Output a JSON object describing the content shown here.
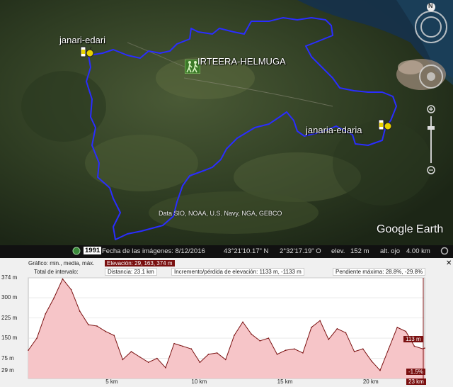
{
  "map": {
    "labels": {
      "janari_edari": "janari-edari",
      "irteera": "IRTEERA-HELMUGA",
      "janaria_edaria": "janaria-edaria"
    },
    "attribution": "Data SIO, NOAA, U.S. Navy, NGA, GEBCO",
    "brand": "Google Earth",
    "route_color": "#2a2dff",
    "compass_letter": "N"
  },
  "statusbar": {
    "year": "1991",
    "imagery_date": "Fecha de las imágenes: 8/12/2016",
    "lat": "43°21'10.17\" N",
    "lon": "2°32'17.19\" O",
    "elev_label": "elev.",
    "elev_value": "152 m",
    "eye_label": "alt. ojo",
    "eye_value": "4.00 km"
  },
  "profile": {
    "graph_label": "Gráfico: min., media, máx.",
    "elevation_stats": "Elevación: 29, 163, 374 m",
    "range_label": "Total de intervalo:",
    "distance": "Distancia: 23.1 km",
    "gain_loss": "Incremento/pérdida de elevación: 1133 m, -1133 m",
    "max_slope": "Pendiente máxima: 28.8%, -29.8%",
    "current_elev": "113 m",
    "current_slope": "-1.5%",
    "current_dist": "23 km"
  },
  "chart_data": {
    "type": "area",
    "xlabel": "",
    "ylabel": "",
    "xlim": [
      0,
      23.1
    ],
    "ylim": [
      0,
      374
    ],
    "y_ticks": [
      "374 m",
      "300 m",
      "225 m",
      "150 m",
      "75 m",
      "29 m"
    ],
    "y_tick_values": [
      374,
      300,
      225,
      150,
      75,
      29
    ],
    "x_ticks": [
      "5 km",
      "10 km",
      "15 km",
      "20 km"
    ],
    "x_tick_values": [
      5,
      10,
      15,
      20
    ],
    "fill_color": "#f6c5c8",
    "line_color": "#7a1010",
    "series": [
      {
        "x": [
          0,
          0.5,
          1,
          1.5,
          2,
          2.5,
          3,
          3.5,
          4,
          4.5,
          5,
          5.5,
          6,
          6.5,
          7,
          7.5,
          8,
          8.5,
          9,
          9.5,
          10,
          10.5,
          11,
          11.5,
          12,
          12.5,
          13,
          13.5,
          14,
          14.5,
          15,
          15.5,
          16,
          16.5,
          17,
          17.5,
          18,
          18.5,
          19,
          19.5,
          20,
          20.5,
          21,
          21.5,
          22,
          22.5,
          23,
          23.1
        ],
        "values": [
          105,
          150,
          240,
          300,
          370,
          330,
          250,
          200,
          195,
          175,
          160,
          70,
          100,
          80,
          60,
          75,
          40,
          130,
          120,
          110,
          60,
          90,
          95,
          70,
          160,
          210,
          165,
          140,
          150,
          90,
          105,
          110,
          95,
          190,
          215,
          145,
          185,
          170,
          100,
          110,
          65,
          30,
          110,
          190,
          175,
          120,
          110,
          113
        ]
      }
    ]
  }
}
